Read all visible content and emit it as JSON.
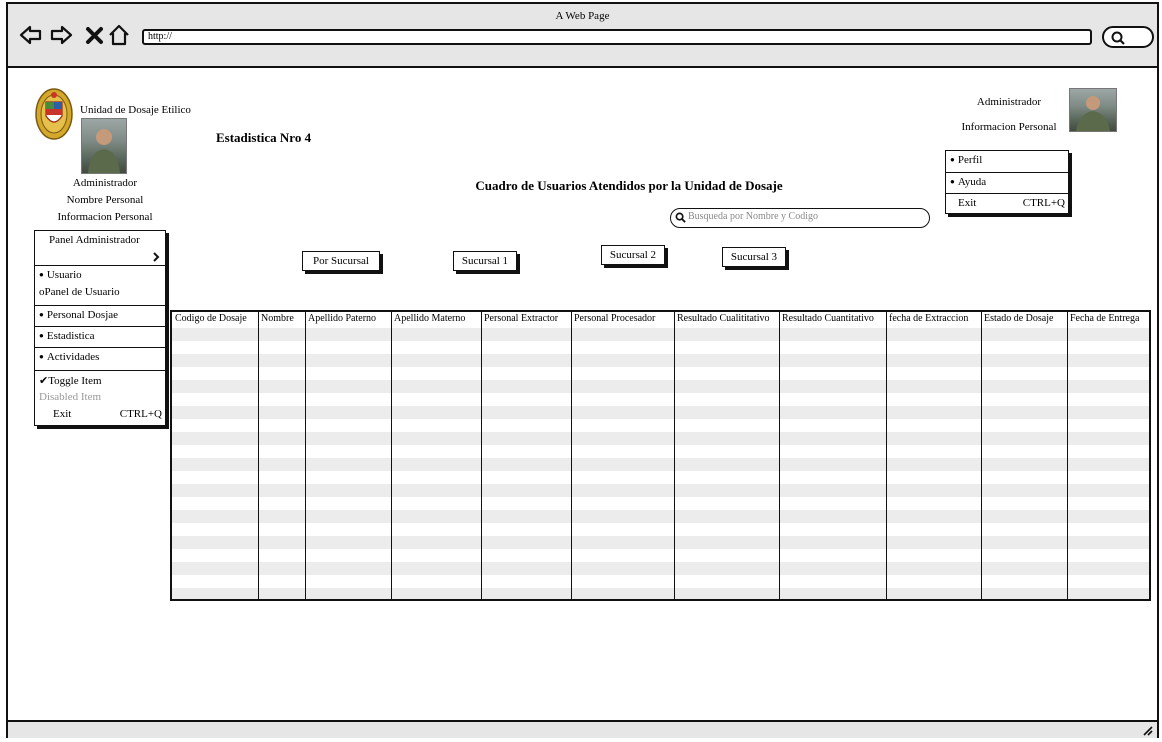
{
  "browser": {
    "window_title": "A Web Page",
    "url": "http://"
  },
  "sidebar": {
    "org_name": "Unidad de Dosaje Etilico",
    "role": "Administrador",
    "name_label": "Nombre  Personal",
    "info_label": "Informacion Personal",
    "menu": {
      "panel_label": "Panel Administrador",
      "items": [
        "Usuario",
        "oPanel de Usuario",
        "Personal Dosjae",
        "Estadistica",
        "Actividades"
      ],
      "toggle_item": "Toggle Item",
      "disabled_item": "Disabled Item",
      "exit_label": "Exit",
      "exit_shortcut": "CTRL+Q"
    }
  },
  "header": {
    "page_title": "Estadistica Nro 4",
    "main_heading": "Cuadro de Usuarios Atendidos por la Unidad de Dosaje"
  },
  "user_panel": {
    "role": "Administrador",
    "info_label": "Informacion Personal",
    "menu": {
      "items": [
        "Perfil",
        "Ayuda"
      ],
      "exit_label": "Exit",
      "exit_shortcut": "CTRL+Q"
    }
  },
  "search": {
    "placeholder": "Busqueda por Nombre y Codigo"
  },
  "filters": [
    "Por Sucursal",
    "Sucursal 1",
    "Sucursal 2",
    "Sucursal 3"
  ],
  "table": {
    "columns": [
      "Codigo de Dosaje",
      "Nombre",
      "Apellido Paterno",
      "Apellido Materno",
      "Personal Extractor",
      "Personal Procesador",
      "Resultado Cualititativo",
      "Resultado Cuantitativo",
      "fecha de Extraccion",
      "Estado de Dosaje",
      "Fecha de Entrega"
    ],
    "rows": []
  }
}
